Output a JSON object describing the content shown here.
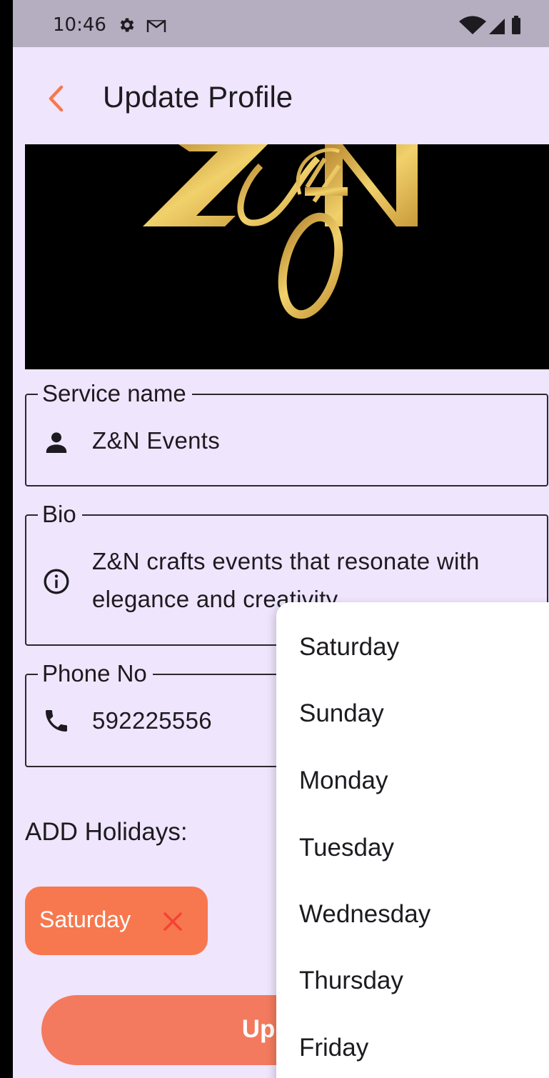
{
  "status_bar": {
    "time": "10:46",
    "icons": [
      "gear-icon",
      "gmail-icon",
      "wifi-icon",
      "signal-icon",
      "battery-icon"
    ]
  },
  "app_bar": {
    "title": "Update Profile",
    "back_icon": "chevron-left-icon",
    "accent_color": "#F7784E"
  },
  "banner": {
    "logo_text": "Z&N",
    "logo_color": "#D8B14A",
    "background": "#000000"
  },
  "form": {
    "service_name": {
      "label": "Service name",
      "value": "Z&N Events",
      "icon": "person-icon"
    },
    "bio": {
      "label": "Bio",
      "value_line1": "Z&N crafts events that resonate with",
      "value_line2": "elegance and creativity",
      "icon": "info-icon"
    },
    "phone": {
      "label": "Phone No",
      "value": "592225556",
      "icon": "phone-icon"
    }
  },
  "holidays": {
    "label": "ADD Holidays:",
    "chips": [
      {
        "label": "Saturday",
        "icon": "close-icon"
      }
    ]
  },
  "update_button": {
    "label": "Update"
  },
  "day_menu": {
    "options": [
      "Saturday",
      "Sunday",
      "Monday",
      "Tuesday",
      "Wednesday",
      "Thursday",
      "Friday"
    ]
  },
  "colors": {
    "background": "#EFE5FD",
    "status_bar": "#B5ADC0",
    "chip": "#F7784E",
    "chip_close": "#F44336",
    "button": "#F37A5E"
  }
}
